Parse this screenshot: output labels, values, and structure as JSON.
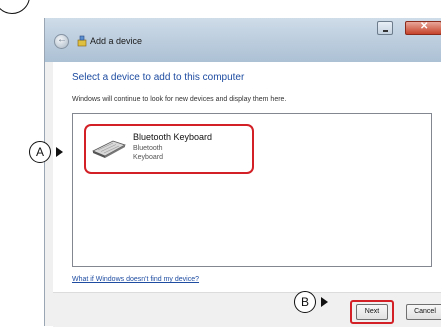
{
  "window": {
    "title": "Add a device"
  },
  "content": {
    "heading": "Select a device to add to this computer",
    "subtext": "Windows will continue to look for new devices and display them here.",
    "devices": [
      {
        "name": "Bluetooth Keyboard",
        "line1": "Bluetooth",
        "line2": "Keyboard",
        "icon": "keyboard-icon"
      }
    ],
    "help_link": "What if Windows doesn't find my device?"
  },
  "footer": {
    "next_label": "Next",
    "cancel_label": "Cancel"
  },
  "callouts": {
    "a": "A",
    "b": "B"
  },
  "colors": {
    "highlight": "#d32027",
    "heading": "#1e4ca1"
  }
}
